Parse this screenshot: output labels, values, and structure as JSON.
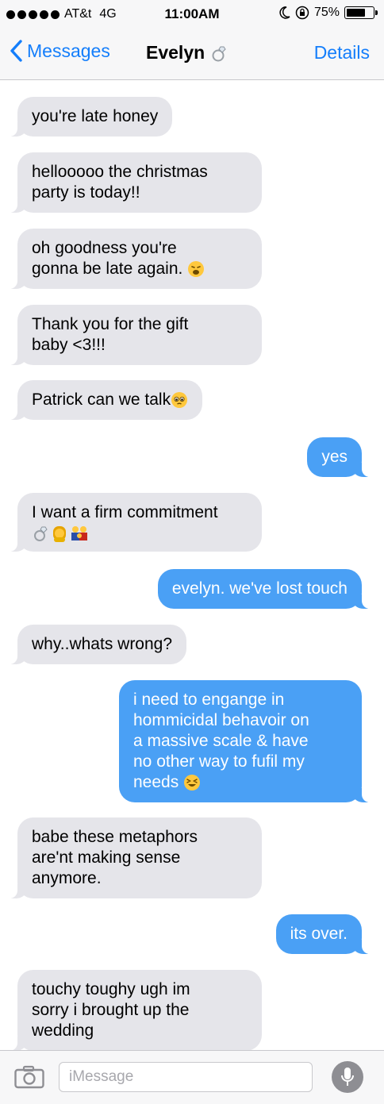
{
  "status_bar": {
    "carrier": "AT&t",
    "network": "4G",
    "time": "11:00AM",
    "battery": "75%",
    "battery_level": 0.75
  },
  "nav": {
    "back_label": "Messages",
    "title": "Evelyn",
    "details_label": "Details"
  },
  "messages": [
    {
      "from": "them",
      "text": "you're late honey"
    },
    {
      "from": "them",
      "line1": "hellooooo the christmas",
      "line2": "party is today!!"
    },
    {
      "from": "them",
      "line1": "oh goodness you're",
      "line2": "gonna be late again."
    },
    {
      "from": "them",
      "line1": "Thank you for the gift",
      "line2": "baby <3!!!"
    },
    {
      "from": "them",
      "text": "Patrick can we talk"
    },
    {
      "from": "me",
      "text": "yes"
    },
    {
      "from": "them",
      "text": "I want a firm commitment"
    },
    {
      "from": "me",
      "text": "evelyn. we've lost touch"
    },
    {
      "from": "them",
      "text": "why..whats wrong?"
    },
    {
      "from": "me",
      "line1": "i need to engange in",
      "line2": "hommicidal behavoir on",
      "line3": "a massive scale & have",
      "line4": "no other way to fufil my",
      "line5": "needs"
    },
    {
      "from": "them",
      "line1": "babe these metaphors",
      "line2": "are'nt making sense",
      "line3": "anymore."
    },
    {
      "from": "me",
      "text": "its over."
    },
    {
      "from": "them",
      "line1": "touchy toughy ugh im",
      "line2": "sorry i brought up the",
      "line3": "wedding"
    }
  ],
  "input": {
    "placeholder": "iMessage"
  },
  "icons": {
    "back": "chevron-left-icon",
    "camera": "camera-icon",
    "mic": "microphone-icon",
    "ring": "ring-emoji"
  },
  "colors": {
    "accent": "#147efb",
    "outgoing_bubble": "#4aa0f5",
    "incoming_bubble": "#e5e5ea"
  }
}
